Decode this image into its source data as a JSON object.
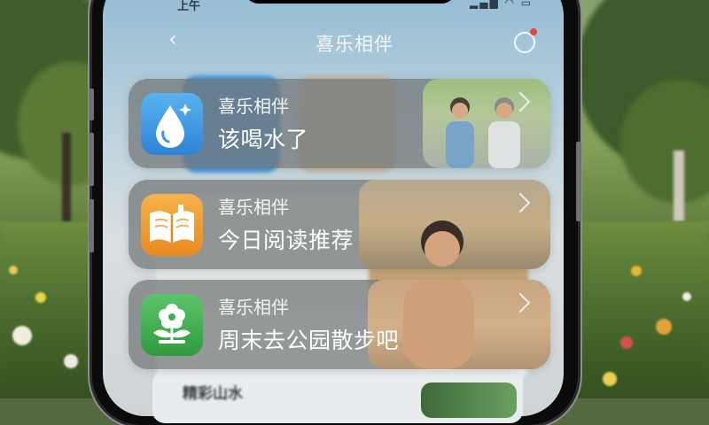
{
  "status_bar": {
    "time": "上午"
  },
  "header": {
    "title": "喜乐相伴"
  },
  "notifications": [
    {
      "app_name": "喜乐相伴",
      "message": "该喝水了",
      "icon": "water-drop-icon"
    },
    {
      "app_name": "喜乐相伴",
      "message": "今日阅读推荐",
      "icon": "open-book-icon"
    },
    {
      "app_name": "喜乐相伴",
      "message": "周末去公园散步吧",
      "icon": "flower-pot-icon"
    }
  ],
  "background_list": {
    "partial_label": "精彩山水"
  },
  "colors": {
    "water_icon": "#3b97e4",
    "reading_icon": "#f09a2c",
    "park_icon": "#3fae4f",
    "notification_bg": "#707574",
    "unread_dot": "#e0463b"
  }
}
